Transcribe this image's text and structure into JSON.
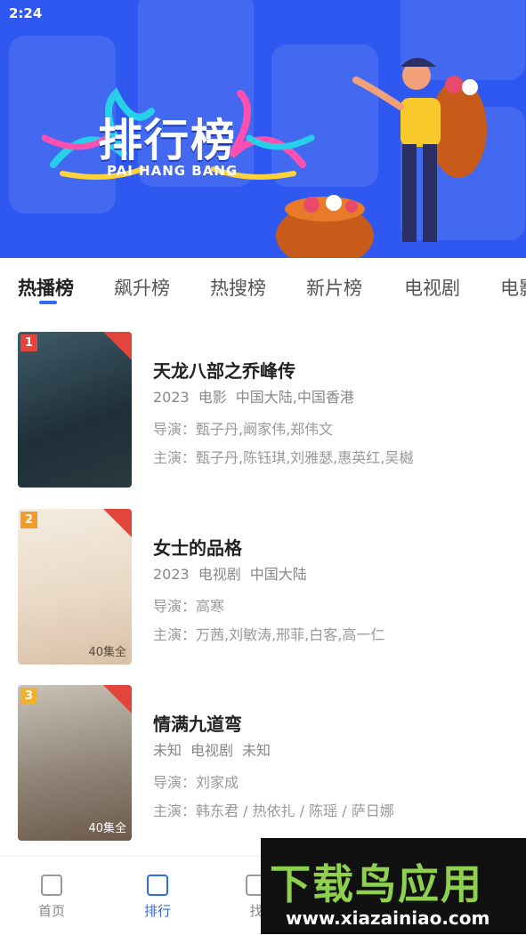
{
  "status_bar": {
    "time": "2:24"
  },
  "banner": {
    "title": "排行榜",
    "subtitle": "PAI HANG BANG"
  },
  "tabs": [
    {
      "label": "热播榜",
      "active": true
    },
    {
      "label": "飙升榜"
    },
    {
      "label": "热搜榜"
    },
    {
      "label": "新片榜"
    },
    {
      "label": "电视剧"
    },
    {
      "label": "电影"
    }
  ],
  "list": [
    {
      "rank": "1",
      "title": "天龙八部之乔峰传",
      "year": "2023",
      "genre": "电影",
      "region": "中国大陆,中国香港",
      "director": "导演：甄子丹,阚家伟,郑伟文",
      "cast": "主演：甄子丹,陈钰琪,刘雅瑟,惠英红,吴樾",
      "poster_caption": ""
    },
    {
      "rank": "2",
      "title": "女士的品格",
      "year": "2023",
      "genre": "电视剧",
      "region": "中国大陆",
      "director": "导演：高寒",
      "cast": "主演：万茜,刘敏涛,邢菲,白客,高一仁",
      "poster_caption": "40集全"
    },
    {
      "rank": "3",
      "title": "情满九道弯",
      "year": "未知",
      "genre": "电视剧",
      "region": "未知",
      "director": "导演：刘家成",
      "cast": "主演：韩东君 / 热依扎 / 陈瑶 / 萨日娜",
      "poster_caption": "40集全"
    }
  ],
  "bottom_nav": [
    {
      "label": "首页"
    },
    {
      "label": "排行",
      "active": true
    },
    {
      "label": "找"
    }
  ],
  "watermark": {
    "text": "下载鸟应用",
    "url": "www.xiazainiao.com"
  },
  "colors": {
    "banner": "#2f58f0",
    "accent": "#2f6bf0",
    "rank1": "#e2453b",
    "rank2": "#f39a2d",
    "rank3": "#f0b030"
  }
}
